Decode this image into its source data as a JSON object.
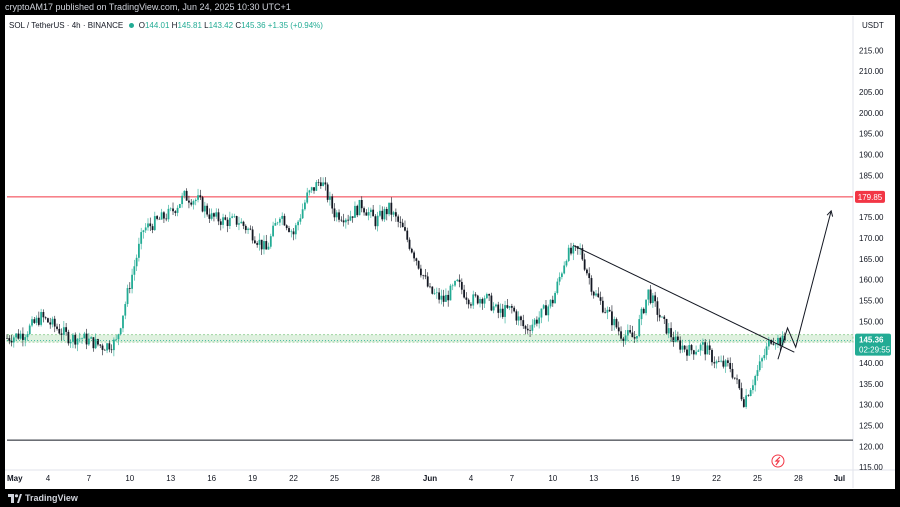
{
  "header": {
    "published": "cryptoAM17 published on TradingView.com, Jun 24, 2025 10:30 UTC+1"
  },
  "footer": {
    "logo_text": "TradingView"
  },
  "legend": {
    "symbol": "SOL / TetherUS · 4h · BINANCE",
    "o_key": "O",
    "o_val": "144.01",
    "h_key": "H",
    "h_val": "145.81",
    "l_key": "L",
    "l_val": "143.42",
    "c_key": "C",
    "c_val": "145.36",
    "change": "+1.35 (+0.94%)"
  },
  "currency": "USDT",
  "colors": {
    "up": "#22ab94",
    "down": "#131722",
    "resistance": "#f23645",
    "support_zone": "#4caf50",
    "price_label": "#22ab94"
  },
  "chart_data": {
    "type": "candlestick",
    "symbol": "SOL / TetherUS",
    "interval": "4h",
    "exchange": "BINANCE",
    "ylim": [
      112,
      218
    ],
    "y_ticks": [
      115,
      120,
      125,
      130,
      135,
      140,
      145,
      150,
      155,
      160,
      165,
      170,
      175,
      180,
      185,
      190,
      195,
      200,
      205,
      210,
      215
    ],
    "y_tick_labels": [
      "115.00",
      "120.00",
      "125.00",
      "130.00",
      "135.00",
      "140.00",
      "145.00",
      "150.00",
      "155.00",
      "160.00",
      "165.00",
      "170.00",
      "175.00",
      "180.00",
      "185.00",
      "190.00",
      "195.00",
      "200.00",
      "205.00",
      "210.00",
      "215.00"
    ],
    "x_ticks": [
      {
        "label": "May",
        "month": true
      },
      {
        "label": "4"
      },
      {
        "label": "7"
      },
      {
        "label": "10"
      },
      {
        "label": "13"
      },
      {
        "label": "16"
      },
      {
        "label": "19"
      },
      {
        "label": "22"
      },
      {
        "label": "25"
      },
      {
        "label": "28"
      },
      {
        "label": "Jun",
        "month": true
      },
      {
        "label": "4"
      },
      {
        "label": "7"
      },
      {
        "label": "10"
      },
      {
        "label": "13"
      },
      {
        "label": "16"
      },
      {
        "label": "19"
      },
      {
        "label": "22"
      },
      {
        "label": "25"
      },
      {
        "label": "28"
      },
      {
        "label": "Jul",
        "month": true
      }
    ],
    "date_start": "2025-05-01",
    "date_end": "2025-07-02",
    "close_path": [
      [
        0,
        146
      ],
      [
        1.2,
        147
      ],
      [
        2.5,
        151
      ],
      [
        3.4,
        149
      ],
      [
        4.6,
        146
      ],
      [
        5.5,
        146
      ],
      [
        7,
        144
      ],
      [
        8,
        145
      ],
      [
        9,
        159
      ],
      [
        10,
        172
      ],
      [
        11,
        174
      ],
      [
        12,
        176
      ],
      [
        13,
        180
      ],
      [
        14,
        179
      ],
      [
        15,
        175
      ],
      [
        16,
        174
      ],
      [
        17,
        174
      ],
      [
        18,
        171
      ],
      [
        19,
        167
      ],
      [
        20,
        176
      ],
      [
        21,
        171
      ],
      [
        22,
        180
      ],
      [
        23,
        184
      ],
      [
        24,
        176
      ],
      [
        25,
        175
      ],
      [
        26,
        178
      ],
      [
        27,
        174
      ],
      [
        28,
        177
      ],
      [
        29,
        172
      ],
      [
        30,
        165
      ],
      [
        31,
        157
      ],
      [
        32,
        155
      ],
      [
        33,
        159
      ],
      [
        34,
        155
      ],
      [
        35,
        156
      ],
      [
        36,
        152
      ],
      [
        37,
        153
      ],
      [
        38,
        148
      ],
      [
        39,
        151
      ],
      [
        40,
        155
      ],
      [
        41,
        166
      ],
      [
        42,
        167
      ],
      [
        43,
        157
      ],
      [
        44,
        152
      ],
      [
        45,
        147
      ],
      [
        46,
        146
      ],
      [
        47,
        157
      ],
      [
        48,
        150
      ],
      [
        49,
        145
      ],
      [
        50,
        143
      ],
      [
        51,
        144
      ],
      [
        52,
        140
      ],
      [
        53,
        139
      ],
      [
        54,
        131
      ],
      [
        55,
        138
      ],
      [
        56,
        146
      ],
      [
        57,
        145
      ]
    ],
    "last_price": "145.36",
    "countdown": "02:29:55",
    "horizontal_levels": [
      {
        "name": "resistance",
        "value": 179.85,
        "label": "179.85"
      },
      {
        "name": "support",
        "value": 121.5
      }
    ],
    "support_zone": [
      145.0,
      146.8
    ],
    "trendline": {
      "from": {
        "x": 41.5,
        "y": 168.2
      },
      "to": {
        "x": 57.7,
        "y": 142.6
      }
    },
    "projection": [
      [
        56.5,
        140.9
      ],
      [
        57.2,
        148.4
      ],
      [
        57.8,
        143.8
      ],
      [
        60.4,
        176.5
      ]
    ],
    "event_marker_day": 56.5
  }
}
